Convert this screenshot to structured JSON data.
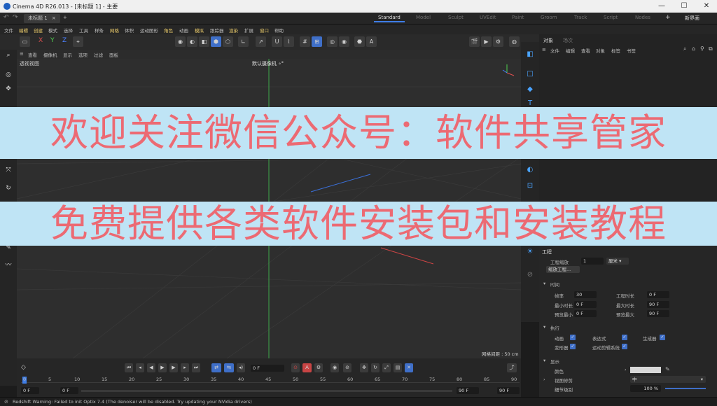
{
  "window": {
    "title": "Cinema 4D R26.013 - [未标题 1] - 主要",
    "minimize": "—",
    "maximize": "☐",
    "close": "✕"
  },
  "tabs": {
    "doc": "未标题 1",
    "doc_close": "×",
    "add": "+",
    "layouts": [
      "Standard",
      "Model",
      "Sculpt",
      "UVEdit",
      "Paint",
      "Groom",
      "Track",
      "Script",
      "Nodes"
    ],
    "add_layout": "+",
    "new_ui": "新界面"
  },
  "menubar": [
    "文件",
    "编辑",
    "创建",
    "模式",
    "选择",
    "工具",
    "样条",
    "网格",
    "体积",
    "运动图形",
    "角色",
    "动画",
    "模拟",
    "跟踪器",
    "渲染",
    "扩展",
    "窗口",
    "帮助"
  ],
  "axes": {
    "x": "X",
    "y": "Y",
    "z": "Z"
  },
  "viewport": {
    "menu": [
      "查看",
      "摄像机",
      "显示",
      "选项",
      "过滤",
      "面板"
    ],
    "name": "透视视图",
    "camera": "默认摄像机 ∘°",
    "grid_spacing": "网格间距 : 50 cm"
  },
  "objects": {
    "tabs": [
      "对象",
      "场次"
    ],
    "menu": [
      "文件",
      "编辑",
      "查看",
      "对象",
      "标签",
      "书签"
    ]
  },
  "attributes": {
    "header": "工程",
    "scale_label": "工程缩放",
    "scale_value": "1",
    "scale_unit": "厘米",
    "scale_button": "缩放工程...",
    "time_section": "时间",
    "fps_label": "帧率",
    "fps_value": "30",
    "project_length_label": "工程时长",
    "project_length_value": "0 F",
    "min_time_label": "最小时长",
    "min_time_value": "0 F",
    "max_time_label": "最大时长",
    "max_time_value": "90 F",
    "preview_min_label": "预览最小",
    "preview_min_value": "0 F",
    "preview_max_label": "预览最大",
    "preview_max_value": "90 F",
    "exec_section": "执行",
    "animation_label": "动画",
    "expression_label": "表达式",
    "generator_label": "生成器",
    "deformer_label": "变形器",
    "motion_label": "运动剪辑系统",
    "display_section": "显示",
    "color_label": "颜色",
    "viewport_clip_label": "视图修剪",
    "viewport_clip_value": "中",
    "lod_label": "细节级别",
    "lod_value": "100 %"
  },
  "timeline": {
    "current_frame": "0 F",
    "ticks": [
      "0",
      "5",
      "10",
      "15",
      "20",
      "25",
      "30",
      "35",
      "40",
      "45",
      "50",
      "55",
      "60",
      "65",
      "70",
      "75",
      "80",
      "85",
      "90"
    ],
    "start": "0 F",
    "start2": "0 F",
    "end": "90 F",
    "end2": "90 F"
  },
  "status": "Redshift Warning: Failed to init Optix 7.4 (The denoiser will be disabled. Try updating your NVidia drivers)",
  "overlay": {
    "line1": "欢迎关注微信公众号：软件共享管家",
    "line2": "免费提供各类软件安装包和安装教程"
  },
  "colors": {
    "accent": "#3f7ee8",
    "banner_bg": "#bfe4f5",
    "banner_text": "#ec6a73",
    "axis_x": "#e05050",
    "axis_y": "#50d050",
    "axis_z": "#4a80ff"
  }
}
